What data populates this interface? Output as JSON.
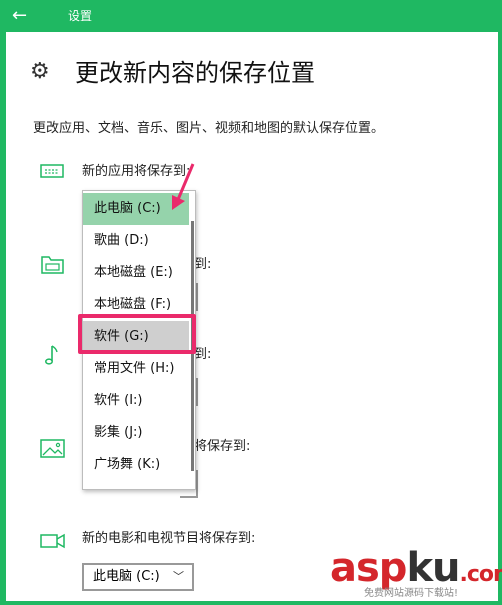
{
  "window": {
    "title": "设置",
    "back_glyph": "←"
  },
  "page": {
    "title": "更改新内容的保存位置",
    "description": "更改应用、文档、音乐、图片、视频和地图的默认保存位置。"
  },
  "categories": {
    "apps": {
      "label": "新的应用将保存到:"
    },
    "documents": {
      "label": "到:"
    },
    "music": {
      "label": "到:"
    },
    "pictures": {
      "label": "将保存到:"
    },
    "videos": {
      "label": "新的电影和电视节目将保存到:",
      "selected": "此电脑 (C:)"
    }
  },
  "dropdown": {
    "items": [
      "此电脑 (C:)",
      "歌曲 (D:)",
      "本地磁盘 (E:)",
      "本地磁盘 (F:)",
      "软件 (G:)",
      "常用文件 (H:)",
      "软件 (I:)",
      "影集 (J:)",
      "广场舞 (K:)"
    ],
    "selected_index": 0,
    "highlighted_index": 4
  },
  "watermark": {
    "brand_asp": "asp",
    "brand_ku": "ku",
    "suffix": ".com",
    "tagline": "免费网站源码下载站!"
  },
  "colors": {
    "accent": "#1fb862",
    "selection": "#95d3ab",
    "annotation": "#ea2a6b"
  }
}
